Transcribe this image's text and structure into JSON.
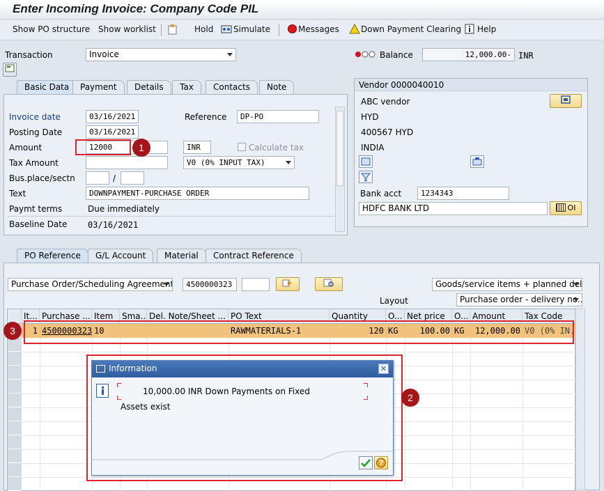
{
  "window": {
    "title": "Enter Incoming Invoice: Company Code PIL"
  },
  "toolbar": {
    "show_po_structure": "Show PO structure",
    "show_worklist": "Show worklist",
    "hold": "Hold",
    "simulate": "Simulate",
    "messages": "Messages",
    "down_payment_clearing": "Down Payment Clearing",
    "help": "Help"
  },
  "header": {
    "transaction_label": "Transaction",
    "transaction_value": "Invoice",
    "balance_label": "Balance",
    "balance_value": "12,000.00-",
    "balance_currency": "INR"
  },
  "tabs_top": [
    "Basic Data",
    "Payment",
    "Details",
    "Tax",
    "Contacts",
    "Note"
  ],
  "basic_data": {
    "invoice_date_label": "Invoice date",
    "invoice_date": "03/16/2021",
    "reference_label": "Reference",
    "reference": "DP-PO",
    "posting_date_label": "Posting Date",
    "posting_date": "03/16/2021",
    "amount_label": "Amount",
    "amount": "12000",
    "currency": "INR",
    "calculate_tax": "Calculate tax",
    "tax_amount_label": "Tax Amount",
    "tax_code": "V0 (0% INPUT TAX)",
    "bus_place_label": "Bus.place/sectn",
    "slash": "/",
    "text_label": "Text",
    "text": "DOWNPAYMENT-PURCHASE ORDER",
    "paymt_terms_label": "Paymt terms",
    "paymt_terms": "Due immediately",
    "baseline_date_label": "Baseline Date",
    "baseline_date": "03/16/2021"
  },
  "vendor": {
    "title": "Vendor 0000040010",
    "name": "ABC vendor",
    "city": "HYD",
    "postal": "400567 HYD",
    "country": "INDIA",
    "bank_acct_label": "Bank acct",
    "bank_acct": "1234343",
    "bank_name": "HDFC BANK LTD",
    "oi_label": "OI"
  },
  "tabs_bottom": [
    "PO Reference",
    "G/L Account",
    "Material",
    "Contract Reference"
  ],
  "po_reference": {
    "doc_type": "Purchase Order/Scheduling Agreement",
    "po_number": "4500000323",
    "goods_service": "Goods/service items + planned deli...",
    "layout_label": "Layout",
    "layout_value": "Purchase order - delivery no..."
  },
  "grid": {
    "columns": [
      "It...",
      "Purchase ...",
      "Item",
      "Sma...",
      "Del. Note/Sheet ...",
      "PO Text",
      "Quantity",
      "O...",
      "Net price",
      "O...",
      "Amount",
      "Tax Code"
    ],
    "rows": [
      {
        "item": "1",
        "po": "4500000323",
        "po_item": "10",
        "sma": "",
        "del_note": "",
        "po_text": "RAWMATERIALS-1",
        "quantity": "120",
        "unit": "KG",
        "net_price": "100.00",
        "price_unit": "KG",
        "amount": "12,000.00",
        "tax_code": "V0 (0% IN..."
      }
    ]
  },
  "dialog": {
    "title": "Information",
    "line1": "10,000.00 INR Down Payments on Fixed",
    "line2": "Assets exist"
  },
  "annotations": {
    "badge1": "1",
    "badge2": "2",
    "badge3": "3"
  },
  "colors": {
    "highlight_row": "#f1c27b",
    "annotation_red": "#e0222b",
    "dialog_title": "#2d5da0"
  }
}
